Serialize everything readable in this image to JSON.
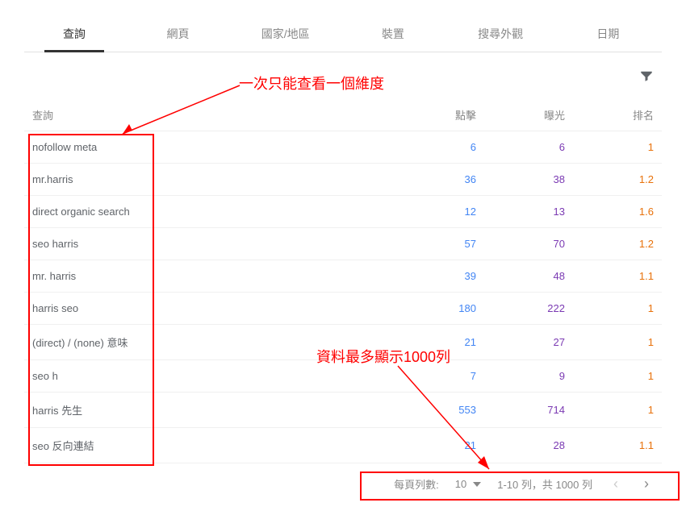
{
  "tabs": {
    "query": "查詢",
    "page": "網頁",
    "country": "國家/地區",
    "device": "裝置",
    "appearance": "搜尋外觀",
    "date": "日期"
  },
  "headers": {
    "query": "查詢",
    "clicks": "點擊",
    "impressions": "曝光",
    "rank": "排名"
  },
  "rows": [
    {
      "query": "nofollow meta",
      "clicks": "6",
      "impressions": "6",
      "rank": "1"
    },
    {
      "query": "mr.harris",
      "clicks": "36",
      "impressions": "38",
      "rank": "1.2"
    },
    {
      "query": "direct organic search",
      "clicks": "12",
      "impressions": "13",
      "rank": "1.6"
    },
    {
      "query": "seo harris",
      "clicks": "57",
      "impressions": "70",
      "rank": "1.2"
    },
    {
      "query": "mr. harris",
      "clicks": "39",
      "impressions": "48",
      "rank": "1.1"
    },
    {
      "query": "harris seo",
      "clicks": "180",
      "impressions": "222",
      "rank": "1"
    },
    {
      "query": "(direct) / (none) 意味",
      "clicks": "21",
      "impressions": "27",
      "rank": "1"
    },
    {
      "query": "seo h",
      "clicks": "7",
      "impressions": "9",
      "rank": "1"
    },
    {
      "query": "harris 先生",
      "clicks": "553",
      "impressions": "714",
      "rank": "1"
    },
    {
      "query": "seo 反向連結",
      "clicks": "21",
      "impressions": "28",
      "rank": "1.1"
    }
  ],
  "footer": {
    "rows_per_page_label": "每頁列數:",
    "rows_per_page_value": "10",
    "range_text": "1-10 列，共 1000 列"
  },
  "annotations": {
    "top": "一次只能查看一個維度",
    "bottom": "資料最多顯示1000列"
  }
}
